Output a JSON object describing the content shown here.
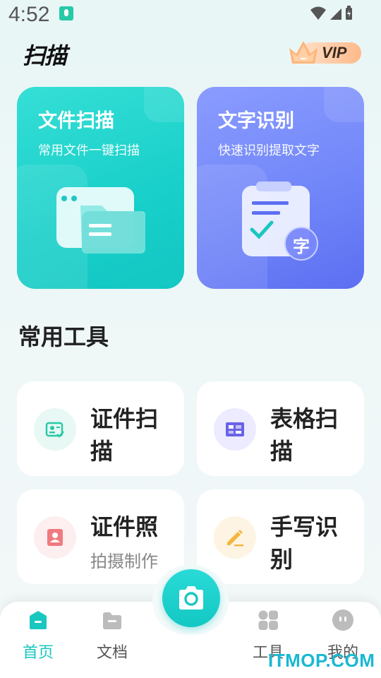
{
  "status_bar": {
    "time": "4:52"
  },
  "header": {
    "app_name": "扫描",
    "vip_label": "VIP"
  },
  "feature_cards": [
    {
      "title": "文件扫描",
      "subtitle": "常用文件一键扫描"
    },
    {
      "title": "文字识别",
      "subtitle": "快速识别提取文字",
      "badge": "字"
    }
  ],
  "section": {
    "title": "常用工具"
  },
  "tools": [
    {
      "title": "证件扫描",
      "subtitle": "",
      "icon": "id-card-icon",
      "color": "#e8f8f4",
      "accent": "#27c9a7"
    },
    {
      "title": "表格扫描",
      "subtitle": "",
      "icon": "table-icon",
      "color": "#ecebff",
      "accent": "#6a63e8"
    },
    {
      "title": "证件照",
      "subtitle": "拍摄制作",
      "icon": "portrait-icon",
      "color": "#fdeff0",
      "accent": "#f07a7f"
    },
    {
      "title": "手写识别",
      "subtitle": "",
      "icon": "pen-icon",
      "color": "#fdf4e3",
      "accent": "#f5b63d"
    }
  ],
  "bottom_nav": {
    "items": [
      {
        "label": "首页",
        "icon": "home-icon",
        "active": true
      },
      {
        "label": "文档",
        "icon": "folder-icon",
        "active": false
      },
      {
        "label": "工具",
        "icon": "grid-icon",
        "active": false
      },
      {
        "label": "我的",
        "icon": "profile-icon",
        "active": false
      }
    ],
    "camera_icon": "camera-icon"
  },
  "watermark": "ITMOP.COM",
  "colors": {
    "accent": "#19c7c1",
    "ocr_card": "#6f84f8"
  }
}
